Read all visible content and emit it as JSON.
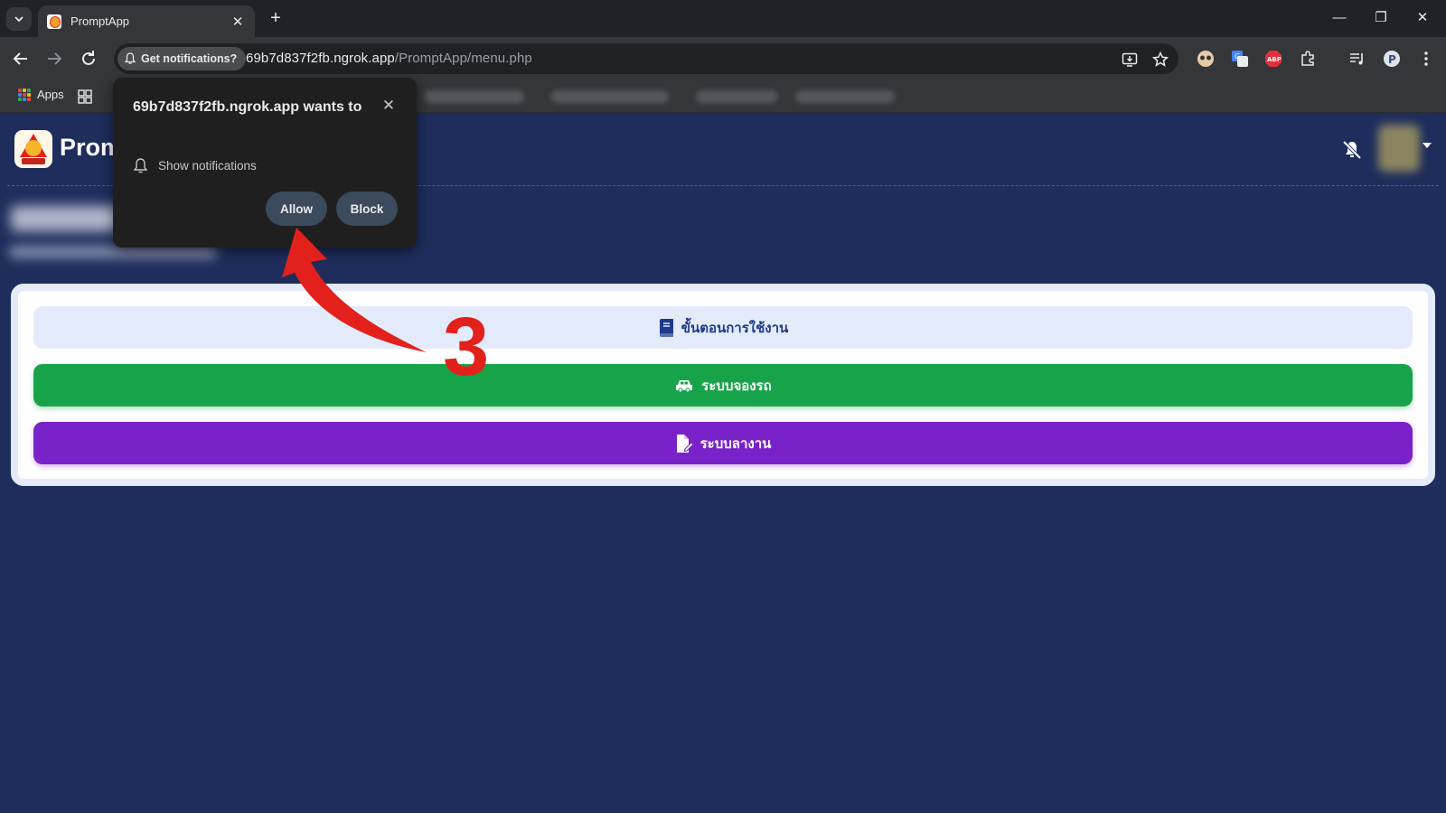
{
  "browser": {
    "tab_title": "PromptApp",
    "omnibox_chip": "Get notifications?",
    "url_host": "69b7d837f2fb.ngrok.app",
    "url_path": "/PromptApp/menu.php",
    "bookmark_apps_label": "Apps"
  },
  "header": {
    "brand": "Prom"
  },
  "menu": {
    "guide_label": "ขั้นตอนการใช้งาน",
    "car_booking_label": "ระบบจองรถ",
    "leave_label": "ระบบลางาน"
  },
  "permission_prompt": {
    "title": "69b7d837f2fb.ngrok.app wants to",
    "permission": "Show notifications",
    "allow_label": "Allow",
    "block_label": "Block"
  },
  "annotation": {
    "step_number": "3"
  },
  "colors": {
    "page_bg": "#1e2d5c",
    "guide_btn": "#e3ebfb",
    "car_btn": "#17a34a",
    "leave_btn": "#7a22c9",
    "annotation_red": "#e3211c"
  }
}
